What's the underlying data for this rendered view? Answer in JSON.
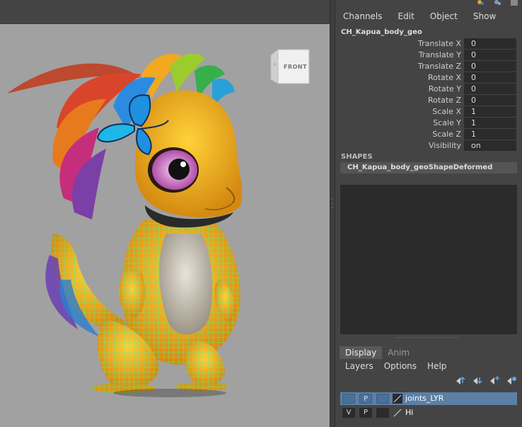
{
  "channel_box": {
    "menus": [
      "Channels",
      "Edit",
      "Object",
      "Show"
    ],
    "object_name": "CH_Kapua_body_geo",
    "attributes": [
      {
        "label": "Translate X",
        "value": "0"
      },
      {
        "label": "Translate Y",
        "value": "0"
      },
      {
        "label": "Translate Z",
        "value": "0"
      },
      {
        "label": "Rotate X",
        "value": "0"
      },
      {
        "label": "Rotate Y",
        "value": "0"
      },
      {
        "label": "Rotate Z",
        "value": "0"
      },
      {
        "label": "Scale X",
        "value": "1"
      },
      {
        "label": "Scale Y",
        "value": "1"
      },
      {
        "label": "Scale Z",
        "value": "1"
      },
      {
        "label": "Visibility",
        "value": "on"
      }
    ],
    "shapes_header": "SHAPES",
    "shape_name": "CH_Kapua_body_geoShapeDeformed"
  },
  "viewport": {
    "viewcube_label": "FRONT",
    "viewcube_side": "R"
  },
  "layer_editor": {
    "tabs": [
      "Display",
      "Anim"
    ],
    "active_tab": "Display",
    "menus": [
      "Layers",
      "Options",
      "Help"
    ],
    "toolbar_icons": [
      "move-layer-up-icon",
      "move-layer-down-icon",
      "new-layer-icon",
      "new-layer-from-selected-icon"
    ],
    "layers": [
      {
        "v": "",
        "p": "P",
        "name": "joints_LYR",
        "selected": true
      },
      {
        "v": "V",
        "p": "P",
        "name": "Hi",
        "selected": false
      }
    ]
  },
  "colors": {
    "selected_layer": "#5b7fa5",
    "wireframe": "#3dff9a",
    "viewport_bg": "#a1a1a1"
  }
}
